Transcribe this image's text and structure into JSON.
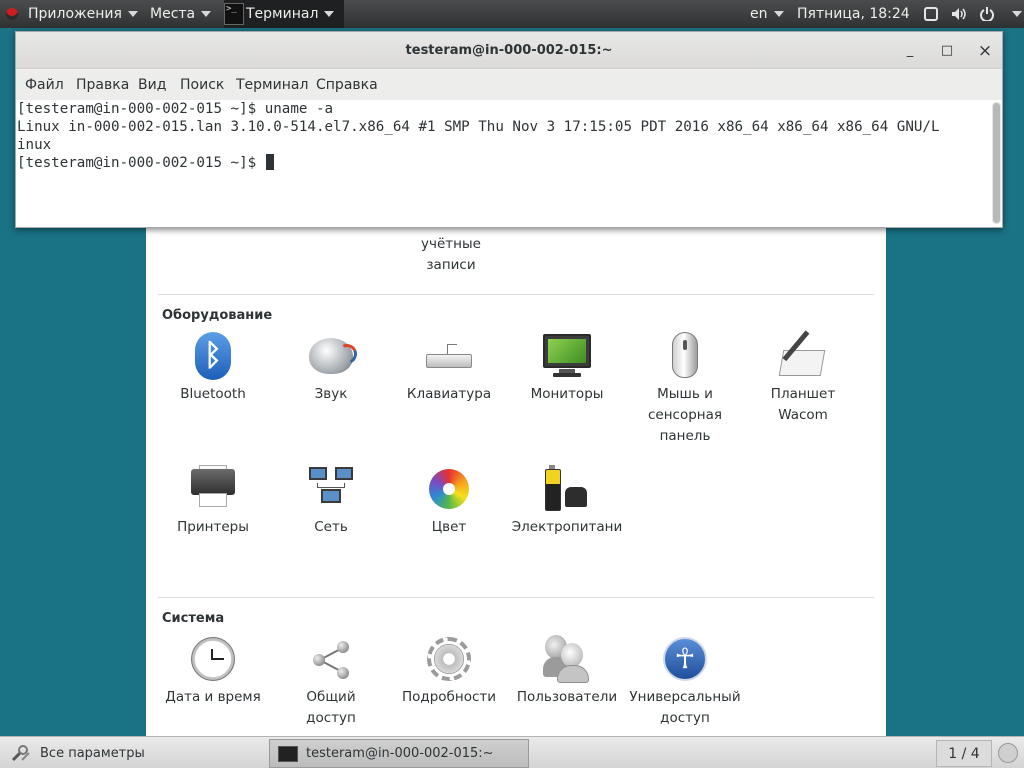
{
  "top_panel": {
    "apps_label": "Приложения",
    "places_label": "Места",
    "terminal_label": "Терминал",
    "terminal_icon_text": ">_",
    "lang": "en",
    "clock": "Пятница, 18:24",
    "tray_icons": [
      "window-icon",
      "volume-icon",
      "power-icon"
    ]
  },
  "settings": {
    "partial_row": {
      "item_label_line1": "учётные",
      "item_label_line2": "записи"
    },
    "hardware": {
      "title": "Оборудование",
      "items": [
        {
          "line1": "Bluetooth",
          "line2": "",
          "line3": "",
          "icon": "bluetooth-icon"
        },
        {
          "line1": "Звук",
          "line2": "",
          "line3": "",
          "icon": "sound-icon"
        },
        {
          "line1": "Клавиатура",
          "line2": "",
          "line3": "",
          "icon": "keyboard-icon"
        },
        {
          "line1": "Мониторы",
          "line2": "",
          "line3": "",
          "icon": "monitor-icon"
        },
        {
          "line1": "Мышь и",
          "line2": "сенсорная",
          "line3": "панель",
          "icon": "mouse-icon"
        },
        {
          "line1": "Планшет",
          "line2": "Wacom",
          "line3": "",
          "icon": "tablet-icon"
        },
        {
          "line1": "Принтеры",
          "line2": "",
          "line3": "",
          "icon": "printer-icon"
        },
        {
          "line1": "Сеть",
          "line2": "",
          "line3": "",
          "icon": "network-icon"
        },
        {
          "line1": "Цвет",
          "line2": "",
          "line3": "",
          "icon": "color-icon"
        },
        {
          "line1": "Электропитани",
          "line2": "",
          "line3": "",
          "icon": "power-battery-icon"
        }
      ]
    },
    "system": {
      "title": "Система",
      "items": [
        {
          "line1": "Дата и время",
          "line2": "",
          "icon": "clock-icon"
        },
        {
          "line1": "Общий",
          "line2": "доступ",
          "icon": "share-icon"
        },
        {
          "line1": "Подробности",
          "line2": "",
          "icon": "gear-icon"
        },
        {
          "line1": "Пользователи",
          "line2": "",
          "icon": "users-icon"
        },
        {
          "line1": "Универсальный",
          "line2": "доступ",
          "icon": "accessibility-icon"
        }
      ]
    }
  },
  "terminal": {
    "title": "testeram@in-000-002-015:~",
    "window_buttons": {
      "minimize": "_",
      "maximize": "□",
      "close": "×"
    },
    "menu": [
      "Файл",
      "Правка",
      "Вид",
      "Поиск",
      "Терминал",
      "Справка"
    ],
    "lines": [
      "[testeram@in-000-002-015 ~]$ uname -a",
      "Linux in-000-002-015.lan 3.10.0-514.el7.x86_64 #1 SMP Thu Nov 3 17:15:05 PDT 2016 x86_64 x86_64 x86_64 GNU/L",
      "inux",
      "[testeram@in-000-002-015 ~]$ "
    ]
  },
  "bottom_panel": {
    "task_settings_label": "Все параметры",
    "task_terminal_label": "testeram@in-000-002-015:~",
    "workspace": "1 / 4"
  }
}
